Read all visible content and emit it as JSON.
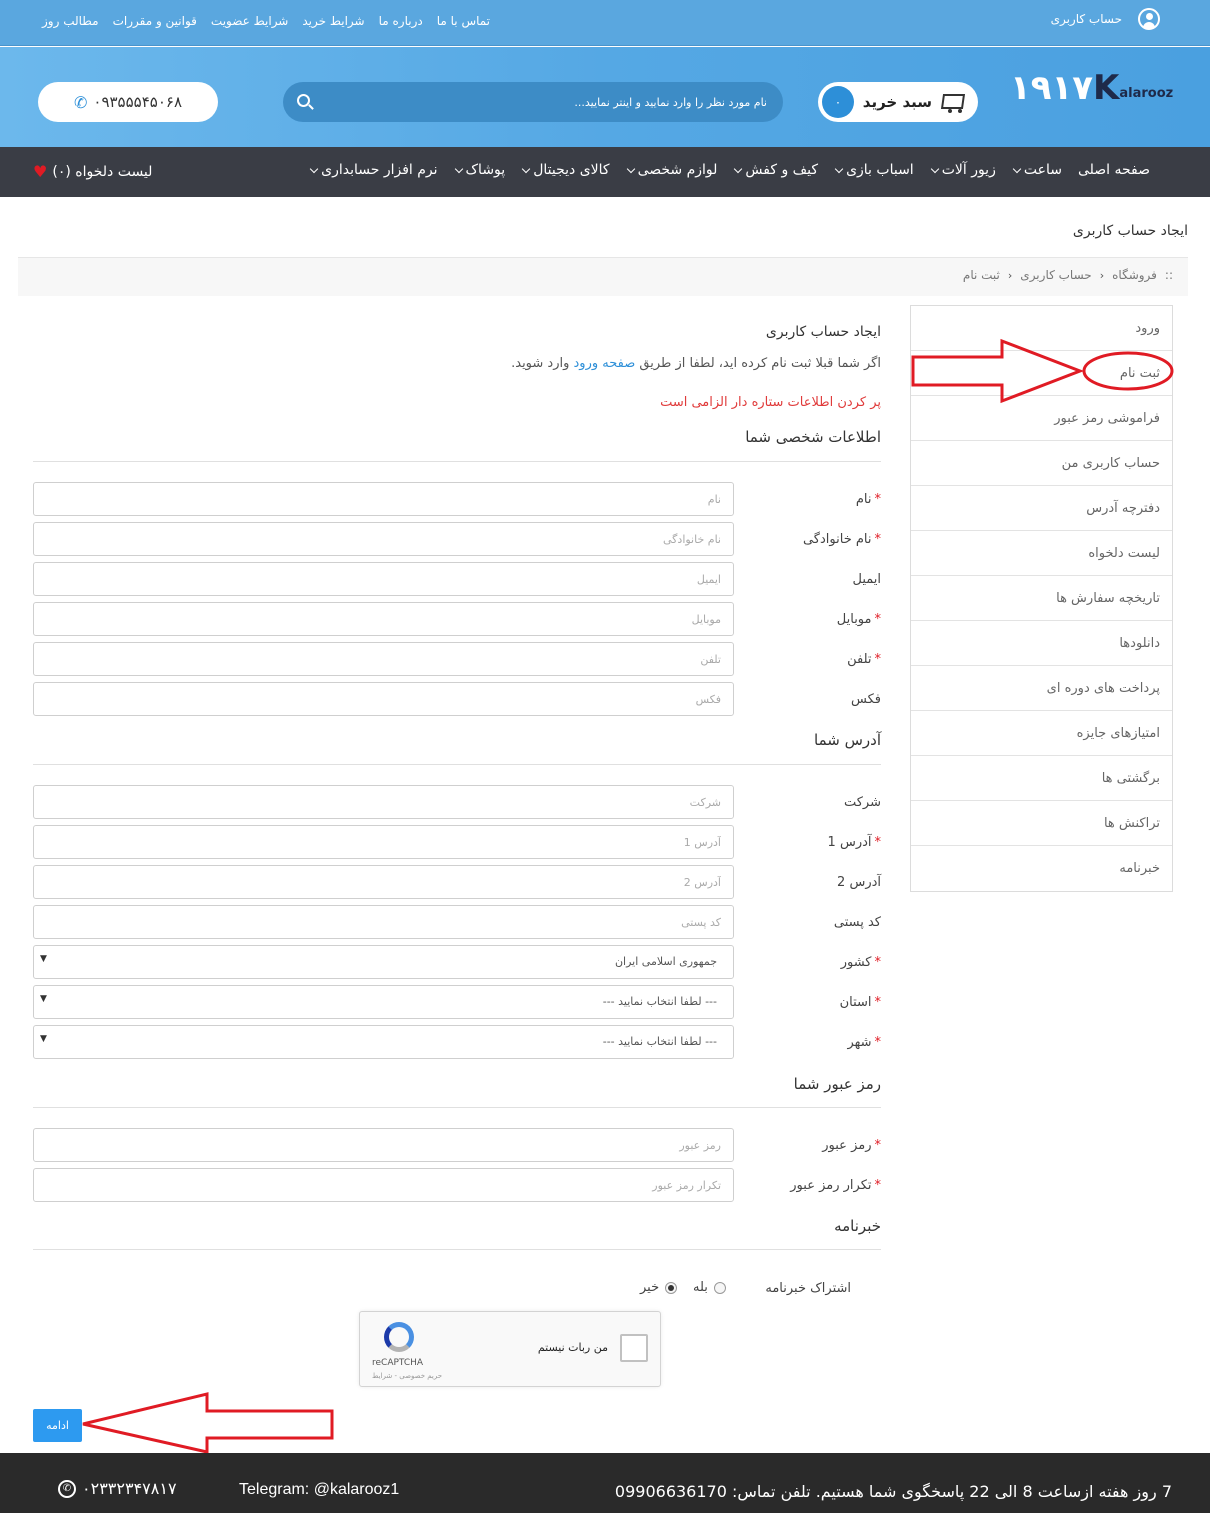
{
  "topbar": {
    "account_label": "حساب کاربری",
    "links": [
      "مطالب روز",
      "قوانین و مقررات",
      "شرایط عضویت",
      "شرایط خرید",
      "درباره ما",
      "تماس با ما"
    ]
  },
  "header": {
    "logo_mark": "۱۹۱۷",
    "logo_k": "K",
    "logo_text": "alarooz",
    "cart_label": "سبد خرید",
    "cart_count": "۰",
    "search_placeholder": "نام مورد نظر را وارد نمایید و اینتر نمایید...",
    "phone": "۰۹۳۵۵۵۴۵۰۶۸"
  },
  "nav": {
    "items": [
      {
        "label": "صفحه اصلی",
        "has_dropdown": false
      },
      {
        "label": "ساعت",
        "has_dropdown": true
      },
      {
        "label": "زیور آلات",
        "has_dropdown": true
      },
      {
        "label": "اسباب بازی",
        "has_dropdown": true
      },
      {
        "label": "کیف و کفش",
        "has_dropdown": true
      },
      {
        "label": "لوازم شخصی",
        "has_dropdown": true
      },
      {
        "label": "کالای دیجیتال",
        "has_dropdown": true
      },
      {
        "label": "پوشاک",
        "has_dropdown": true
      },
      {
        "label": "نرم افزار حسابداری",
        "has_dropdown": true
      }
    ],
    "wishlist": "لیست دلخواه (۰)"
  },
  "page": {
    "title": "ایجاد حساب کاربری",
    "breadcrumb": [
      "فروشگاه",
      "حساب کاربری",
      "ثبت نام"
    ]
  },
  "sidebar": {
    "items": [
      "ورود",
      "ثبت نام",
      "فراموشی رمز عبور",
      "حساب کاربری من",
      "دفترچه آدرس",
      "لیست دلخواه",
      "تاریخچه سفارش ها",
      "دانلودها",
      "پرداخت های دوره ای",
      "امتیازهای جایزه",
      "برگشتی ها",
      "تراکنش ها",
      "خبرنامه"
    ]
  },
  "form": {
    "heading": "ایجاد حساب کاربری",
    "intro_before": "اگر شما قبلا ثبت نام کرده اید، لطفا از طریق ",
    "intro_link": "صفحه ورود",
    "intro_after": " وارد شوید.",
    "required_note": "پر کردن اطلاعات ستاره دار الزامی است",
    "personal_title": "اطلاعات شخصی شما",
    "personal_fields": [
      {
        "label": "نام",
        "placeholder": "نام",
        "required": true
      },
      {
        "label": "نام خانوادگی",
        "placeholder": "نام خانوادگی",
        "required": true
      },
      {
        "label": "ایمیل",
        "placeholder": "ایمیل",
        "required": false
      },
      {
        "label": "موبایل",
        "placeholder": "موبایل",
        "required": true
      },
      {
        "label": "تلفن",
        "placeholder": "تلفن",
        "required": true
      },
      {
        "label": "فکس",
        "placeholder": "فکس",
        "required": false
      }
    ],
    "address_title": "آدرس شما",
    "address_fields": [
      {
        "label": "شرکت",
        "placeholder": "شرکت",
        "required": false
      },
      {
        "label": "آدرس 1",
        "placeholder": "آدرس 1",
        "required": true
      },
      {
        "label": "آدرس 2",
        "placeholder": "آدرس 2",
        "required": false
      },
      {
        "label": "کد پستی",
        "placeholder": "کد پستی",
        "required": false
      }
    ],
    "address_selects": [
      {
        "label": "کشور",
        "value": "جمهوری اسلامی ایران",
        "required": true
      },
      {
        "label": "استان",
        "value": "--- لطفا انتخاب نمایید ---",
        "required": true
      },
      {
        "label": "شهر",
        "value": "--- لطفا انتخاب نمایید ---",
        "required": true
      }
    ],
    "password_title": "رمز عبور شما",
    "password_fields": [
      {
        "label": "رمز عبور",
        "placeholder": "رمز عبور",
        "required": true
      },
      {
        "label": "تکرار رمز عبور",
        "placeholder": "تکرار رمز عبور",
        "required": true
      }
    ],
    "newsletter_title": "خبرنامه",
    "newsletter_label": "اشتراک خبرنامه",
    "newsletter_yes": "بله",
    "newsletter_no": "خیر",
    "newsletter_selected": "no",
    "captcha_label": "من ربات نیستم",
    "captcha_brand": "reCAPTCHA",
    "captcha_terms": "حریم خصوصی - شرایط",
    "submit_label": "ادامه"
  },
  "footer": {
    "hours": "7 روز هفته ازساعت 8 الی 22 پاسخگوی شما هستیم. تلفن تماس: 09906636170",
    "telegram": "Telegram: @kalarooz1",
    "phone": "۰۲۳۳۲۳۴۷۸۱۷"
  },
  "colors": {
    "topbar": "#5aa7df",
    "nav": "#3a3d45",
    "accent": "#2d9af0",
    "required": "#e01b24",
    "annotation": "#e01b24",
    "footer": "#2a2a2a"
  }
}
